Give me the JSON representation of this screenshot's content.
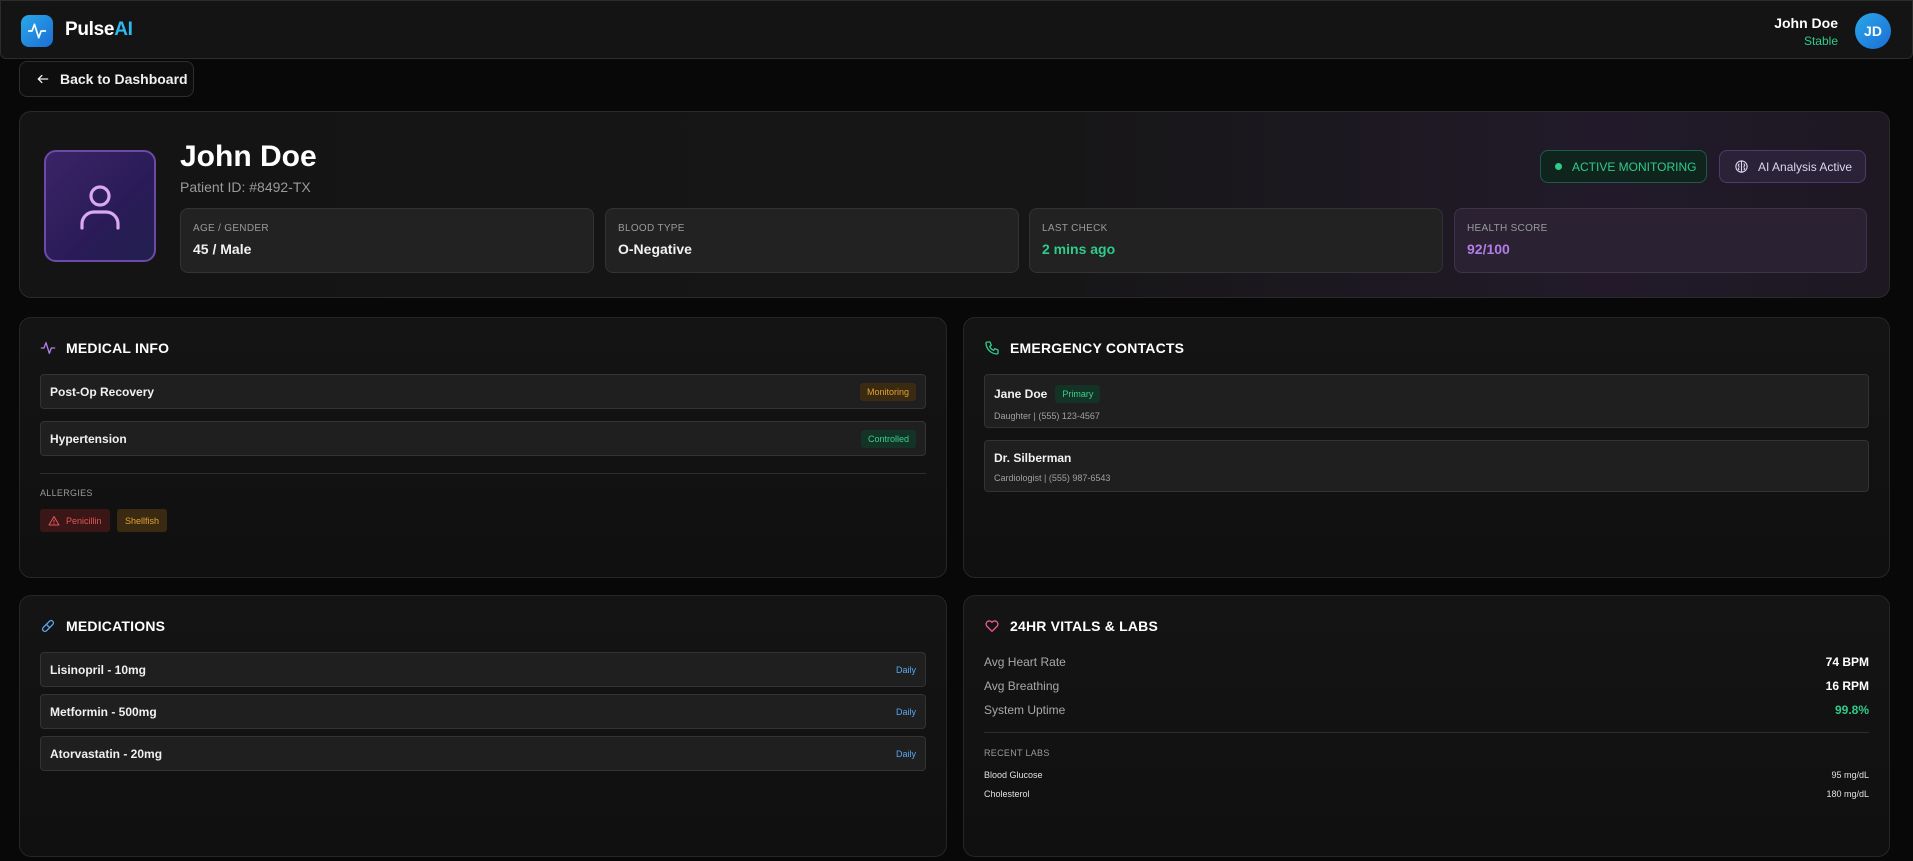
{
  "app": {
    "brand_main": "Pulse",
    "brand_accent": "AI",
    "accent_color": "#2fb8ef"
  },
  "user": {
    "name": "John Doe",
    "status": "Stable",
    "initials": "JD"
  },
  "nav": {
    "back_label": "Back to Dashboard"
  },
  "patient": {
    "name": "John Doe",
    "id_text": "Patient ID: #8492-TX",
    "badges": {
      "monitoring": "ACTIVE MONITORING",
      "ai": "AI Analysis Active"
    },
    "stats": [
      {
        "label": "AGE / GENDER",
        "value": "45 / Male"
      },
      {
        "label": "BLOOD TYPE",
        "value": "O-Negative"
      },
      {
        "label": "LAST CHECK",
        "value": "2 mins ago"
      },
      {
        "label": "HEALTH SCORE",
        "value": "92/100"
      }
    ]
  },
  "medical_info": {
    "title": "MEDICAL INFO",
    "icon": "activity-icon",
    "conditions": [
      {
        "name": "Post-Op Recovery",
        "status": "Monitoring"
      },
      {
        "name": "Hypertension",
        "status": "Controlled"
      }
    ],
    "allergies_label": "ALLERGIES",
    "allergies": [
      "Penicillin",
      "Shellfish"
    ]
  },
  "emergency_contacts": {
    "title": "EMERGENCY CONTACTS",
    "icon": "phone-icon",
    "contacts": [
      {
        "name": "Jane Doe",
        "tag": "Primary",
        "details": "Daughter | (555) 123-4567"
      },
      {
        "name": "Dr. Silberman",
        "details": "Cardiologist | (555) 987-6543"
      }
    ]
  },
  "medications": {
    "title": "MEDICATIONS",
    "icon": "pill-icon",
    "items": [
      {
        "name": "Lisinopril - 10mg",
        "frequency": "Daily"
      },
      {
        "name": "Metformin - 500mg",
        "frequency": "Daily"
      },
      {
        "name": "Atorvastatin - 20mg",
        "frequency": "Daily"
      }
    ]
  },
  "vitals": {
    "title": "24HR VITALS & LABS",
    "icon": "heart-icon",
    "items": [
      {
        "label": "Avg Heart Rate",
        "value": "74 BPM"
      },
      {
        "label": "Avg Breathing",
        "value": "16 RPM"
      },
      {
        "label": "System Uptime",
        "value": "99.8%"
      }
    ],
    "labs_label": "RECENT LABS",
    "labs": [
      {
        "label": "Blood Glucose",
        "value": "95 mg/dL"
      },
      {
        "label": "Cholesterol",
        "value": "180 mg/dL"
      }
    ]
  }
}
